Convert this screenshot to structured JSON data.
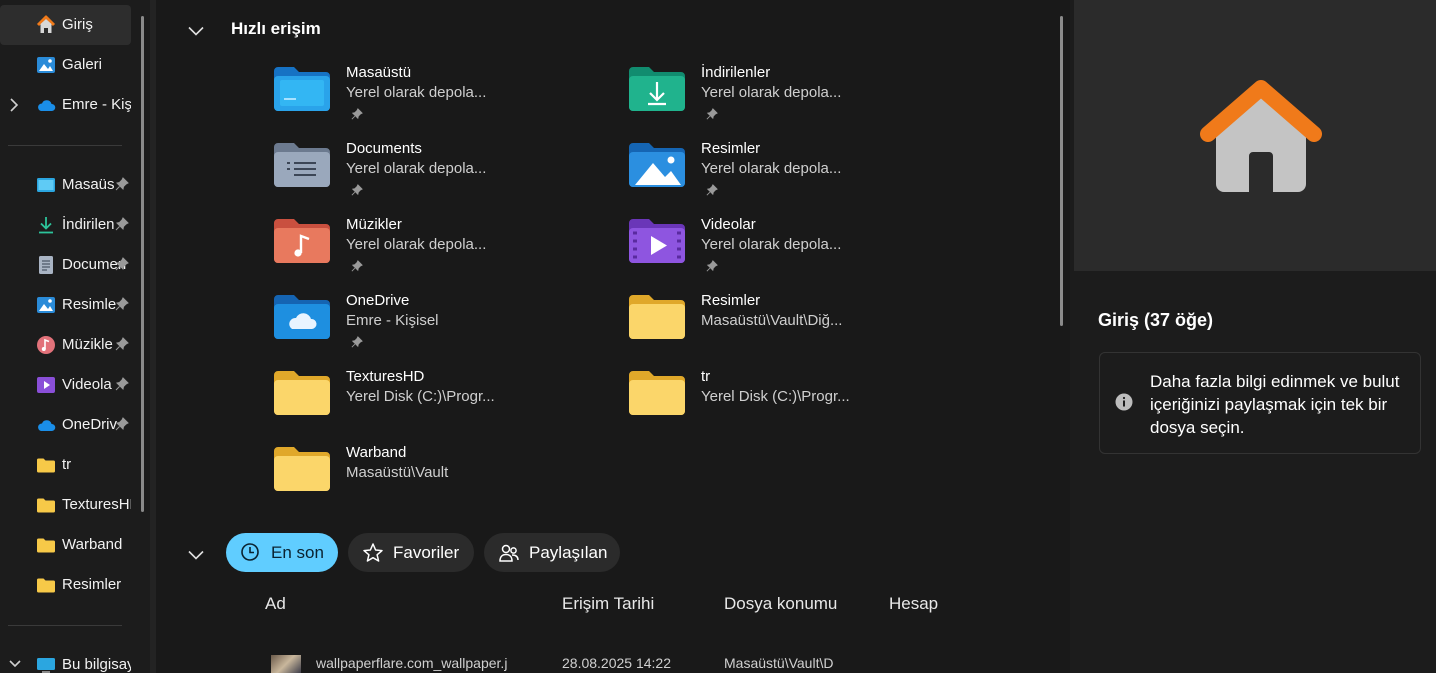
{
  "sidebar": {
    "items": [
      {
        "label": "Giriş",
        "icon": "home-icon",
        "selected": true,
        "pinned": false
      },
      {
        "label": "Galeri",
        "icon": "gallery-icon",
        "selected": false,
        "pinned": false
      },
      {
        "label": "Emre - Kişi",
        "icon": "onedrive-cloud-icon",
        "selected": false,
        "pinned": false,
        "expandable": true
      },
      {
        "label": "Masaüs",
        "icon": "desktop-icon",
        "pinned": true
      },
      {
        "label": "İndirilen",
        "icon": "download-icon",
        "pinned": true
      },
      {
        "label": "Documen",
        "icon": "document-icon",
        "pinned": true
      },
      {
        "label": "Resimle",
        "icon": "pictures-icon",
        "pinned": true
      },
      {
        "label": "Müzikle",
        "icon": "music-icon",
        "pinned": true
      },
      {
        "label": "Videola",
        "icon": "video-icon",
        "pinned": true
      },
      {
        "label": "OneDriv",
        "icon": "onedrive-cloud-icon",
        "pinned": true
      },
      {
        "label": "tr",
        "icon": "folder-icon",
        "pinned": false
      },
      {
        "label": "TexturesHD",
        "icon": "folder-icon",
        "pinned": false
      },
      {
        "label": "Warband",
        "icon": "folder-icon",
        "pinned": false
      },
      {
        "label": "Resimler",
        "icon": "folder-icon",
        "pinned": false
      },
      {
        "label": "Bu bilgisay",
        "icon": "computer-icon",
        "pinned": false,
        "expandable": true
      }
    ]
  },
  "quick_access": {
    "title": "Hızlı erişim",
    "items": [
      {
        "name": "Masaüstü",
        "location": "Yerel olarak depola...",
        "icon": "desktop-folder-icon",
        "pinned": true
      },
      {
        "name": "İndirilenler",
        "location": "Yerel olarak depola...",
        "icon": "downloads-folder-icon",
        "pinned": true
      },
      {
        "name": "Documents",
        "location": "Yerel olarak depola...",
        "icon": "documents-folder-icon",
        "pinned": true
      },
      {
        "name": "Resimler",
        "location": "Yerel olarak depola...",
        "icon": "pictures-folder-icon",
        "pinned": true
      },
      {
        "name": "Müzikler",
        "location": "Yerel olarak depola...",
        "icon": "music-folder-icon",
        "pinned": true
      },
      {
        "name": "Videolar",
        "location": "Yerel olarak depola...",
        "icon": "videos-folder-icon",
        "pinned": true
      },
      {
        "name": "OneDrive",
        "location": "Emre - Kişisel",
        "icon": "onedrive-folder-icon",
        "pinned": true
      },
      {
        "name": "Resimler",
        "location": "Masaüstü\\Vault\\Diğ...",
        "icon": "folder-icon",
        "pinned": false
      },
      {
        "name": "TexturesHD",
        "location": "Yerel Disk (C:)\\Progr...",
        "icon": "folder-icon",
        "pinned": false
      },
      {
        "name": "tr",
        "location": "Yerel Disk (C:)\\Progr...",
        "icon": "folder-icon",
        "pinned": false
      },
      {
        "name": "Warband",
        "location": "Masaüstü\\Vault",
        "icon": "folder-icon",
        "pinned": false
      }
    ]
  },
  "recent": {
    "tabs": [
      {
        "label": "En son",
        "icon": "clock-icon",
        "active": true
      },
      {
        "label": "Favoriler",
        "icon": "star-icon",
        "active": false
      },
      {
        "label": "Paylaşılan",
        "icon": "people-icon",
        "active": false
      }
    ],
    "columns": [
      "Ad",
      "Erişim Tarihi",
      "Dosya konumu",
      "Hesap"
    ],
    "rows": [
      {
        "name": "wallpaperflare.com_wallpaper.j",
        "date": "28.08.2025 14:22",
        "location": "Masaüstü\\Vault\\D",
        "account": ""
      }
    ]
  },
  "details": {
    "title": "Giriş (37 öğe)",
    "info": "Daha fazla bilgi edinmek ve bulut içeriğinizi paylaşmak için tek bir dosya seçin."
  },
  "colors": {
    "accent": "#60cdff",
    "folder_yellow": "#f7c948",
    "home_orange": "#f07a1a"
  }
}
